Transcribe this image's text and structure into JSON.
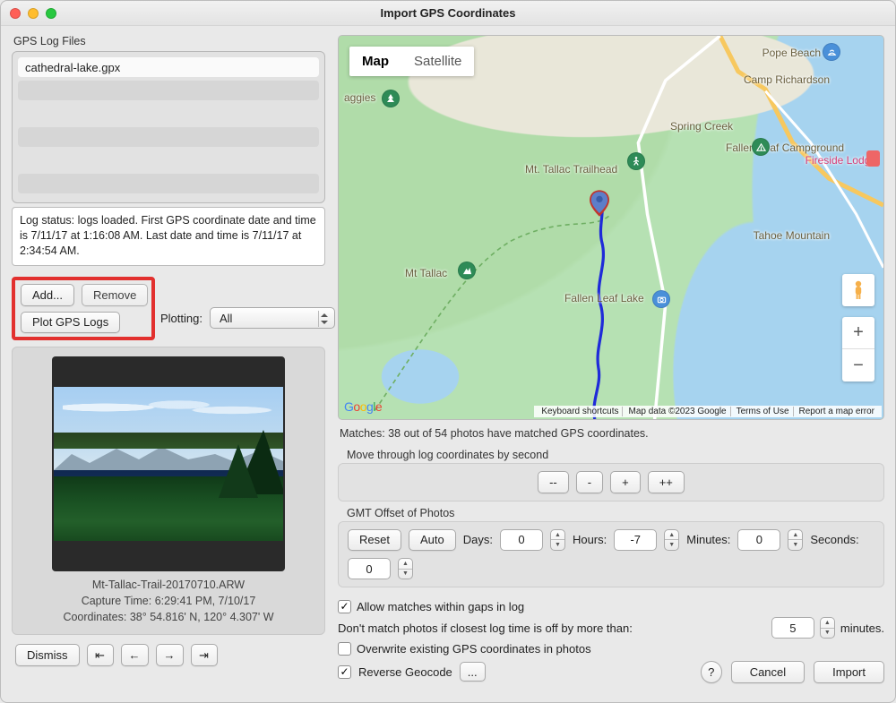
{
  "window": {
    "title": "Import GPS Coordinates"
  },
  "left": {
    "section_label": "GPS Log Files",
    "file_name": "cathedral-lake.gpx",
    "status": "Log status: logs loaded.  First GPS coordinate date and time is 7/11/17 at 1:16:08 AM.  Last date and time is 7/11/17 at 2:34:54 AM.",
    "add_label": "Add...",
    "remove_label": "Remove",
    "plot_label": "Plot GPS Logs",
    "plotting_label": "Plotting:",
    "plotting_value": "All",
    "photo": {
      "file": "Mt-Tallac-Trail-20170710.ARW",
      "capture_prefix": "Capture Time: ",
      "capture_time": "6:29:41 PM, 7/10/17",
      "coords_prefix": "Coordinates: ",
      "coords": "38° 54.816' N, 120° 4.307' W"
    },
    "dismiss": "Dismiss",
    "nav": {
      "first": "⇤",
      "prev": "←",
      "next": "→",
      "last": "⇥"
    }
  },
  "map": {
    "tab_map": "Map",
    "tab_sat": "Satellite",
    "labels": {
      "pope_beach": "Pope Beach",
      "camp_rich": "Camp Richardson",
      "spring_creek": "Spring Creek",
      "fallen_leaf_cg": "Fallen Leaf Campground",
      "mt_tallac_th": "Mt. Tallac Trailhead",
      "fireside": "Fireside Lodge",
      "tahoe_mtn": "Tahoe Mountain",
      "mt_tallac": "Mt Tallac",
      "fallen_lake": "Fallen Leaf Lake",
      "aggies": "aggies"
    },
    "attr": {
      "shortcuts": "Keyboard shortcuts",
      "data": "Map data ©2023 Google",
      "terms": "Terms of Use",
      "report": "Report a map error"
    }
  },
  "matches": "Matches: 38 out of 54 photos have matched GPS coordinates.",
  "move": {
    "label": "Move through log coordinates by second",
    "b1": "--",
    "b2": "-",
    "b3": "+",
    "b4": "++"
  },
  "gmt": {
    "label": "GMT Offset of Photos",
    "reset": "Reset",
    "auto": "Auto",
    "days_l": "Days:",
    "days_v": "0",
    "hours_l": "Hours:",
    "hours_v": "-7",
    "minutes_l": "Minutes:",
    "minutes_v": "0",
    "seconds_l": "Seconds:",
    "seconds_v": "0"
  },
  "opts": {
    "allow_gaps": "Allow matches within gaps in log",
    "dont_match_prefix": "Don't match photos if closest log time is off by more than:",
    "dont_match_val": "5",
    "dont_match_suffix": "minutes.",
    "overwrite": "Overwrite existing GPS coordinates in photos",
    "reverse": "Reverse Geocode",
    "reverse_btn": "...",
    "help": "?",
    "cancel": "Cancel",
    "import": "Import"
  }
}
